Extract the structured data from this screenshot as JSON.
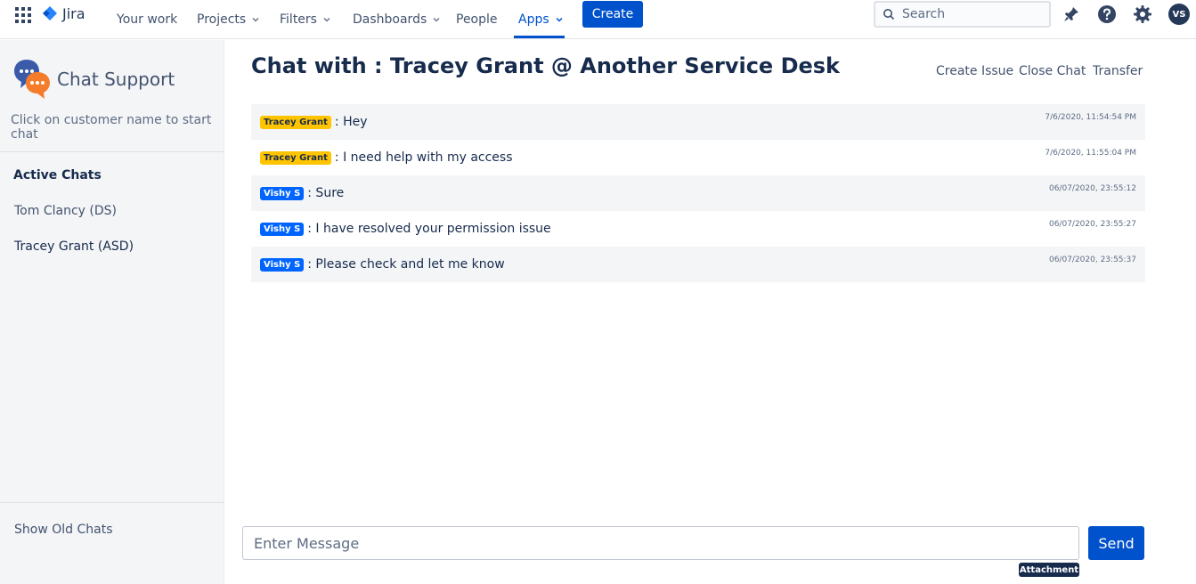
{
  "topnav": {
    "logo": "Jira",
    "items": [
      {
        "label": "Your work",
        "dropdown": false
      },
      {
        "label": "Projects",
        "dropdown": true
      },
      {
        "label": "Filters",
        "dropdown": true
      },
      {
        "label": "Dashboards",
        "dropdown": true
      },
      {
        "label": "People",
        "dropdown": false
      },
      {
        "label": "Apps",
        "dropdown": true,
        "active": true
      }
    ],
    "create_label": "Create",
    "search_placeholder": "Search",
    "avatar_initials": "VS",
    "icons": [
      "app-switcher-icon",
      "notifications-icon",
      "help-icon",
      "settings-icon"
    ]
  },
  "sidebar": {
    "title": "Chat Support",
    "subtitle": "Click on customer name to start chat",
    "active_heading": "Active Chats",
    "chats": [
      {
        "label": "Tom Clancy (DS)"
      },
      {
        "label": "Tracey Grant (ASD)"
      }
    ],
    "show_old": "Show Old Chats"
  },
  "main": {
    "title": "Chat with : Tracey Grant @ Another Service Desk",
    "actions": {
      "create_issue": "Create Issue",
      "close_chat": "Close Chat",
      "transfer": "Transfer"
    },
    "messages": [
      {
        "sender": "Tracey Grant",
        "role": "customer",
        "text": ": Hey",
        "time": "7/6/2020, 11:54:54 PM"
      },
      {
        "sender": "Tracey Grant",
        "role": "customer",
        "text": ": I need help with my access",
        "time": "7/6/2020, 11:55:04 PM"
      },
      {
        "sender": "Vishy S",
        "role": "agent",
        "text": ": Sure",
        "time": "06/07/2020, 23:55:12"
      },
      {
        "sender": "Vishy S",
        "role": "agent",
        "text": ": I have resolved your permission issue",
        "time": "06/07/2020, 23:55:27"
      },
      {
        "sender": "Vishy S",
        "role": "agent",
        "text": ": Please check and let me know",
        "time": "06/07/2020, 23:55:37"
      }
    ]
  },
  "composer": {
    "placeholder": "Enter Message",
    "send_label": "Send",
    "attachment_tooltip": "Attachment"
  },
  "colors": {
    "brand": "#0052CC",
    "customer_badge": "#FFC400",
    "agent_badge": "#0065FF",
    "sidebar_bg": "#F4F5F7"
  }
}
